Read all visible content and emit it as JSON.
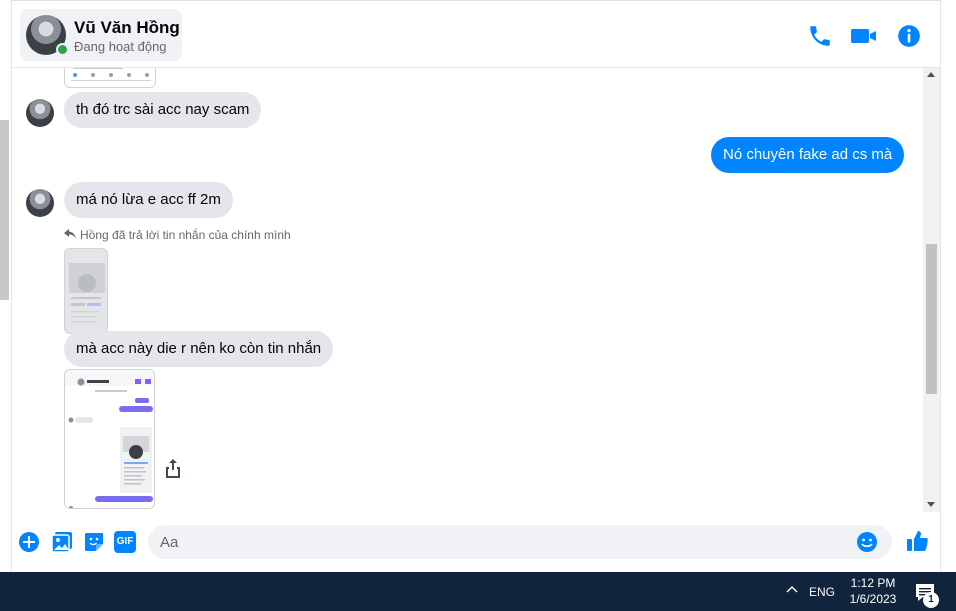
{
  "header": {
    "contact_name": "Vũ Văn Hồng",
    "contact_status": "Đang hoạt động",
    "icons": [
      "phone-icon",
      "video-camera-icon",
      "info-icon"
    ]
  },
  "messages": [
    {
      "from": "them",
      "text": "th đó trc sài acc nay scam"
    },
    {
      "from": "me",
      "text": "Nó chuyên fake ad cs mà"
    },
    {
      "from": "them",
      "text": "má nó lừa e acc ff 2m"
    },
    {
      "from": "them",
      "type": "reply-note",
      "text": "Hồng đã trả lời tin nhắn của chính mình"
    },
    {
      "from": "them",
      "text": "mà acc này die r nên ko còn tin nhắn"
    }
  ],
  "composer": {
    "placeholder": "Aa",
    "value": "",
    "icons": [
      "plus-icon",
      "image-icon",
      "sticker-icon",
      "gif-icon",
      "emoji-icon",
      "like-icon"
    ],
    "gif_label": "GIF"
  },
  "taskbar": {
    "language": "ENG",
    "time": "1:12 PM",
    "date": "1/6/2023",
    "notification_count": "1"
  },
  "colors": {
    "accent": "#0084ff",
    "incoming_bubble": "#e4e6eb",
    "online": "#31a24c",
    "taskbar": "#10253d"
  }
}
